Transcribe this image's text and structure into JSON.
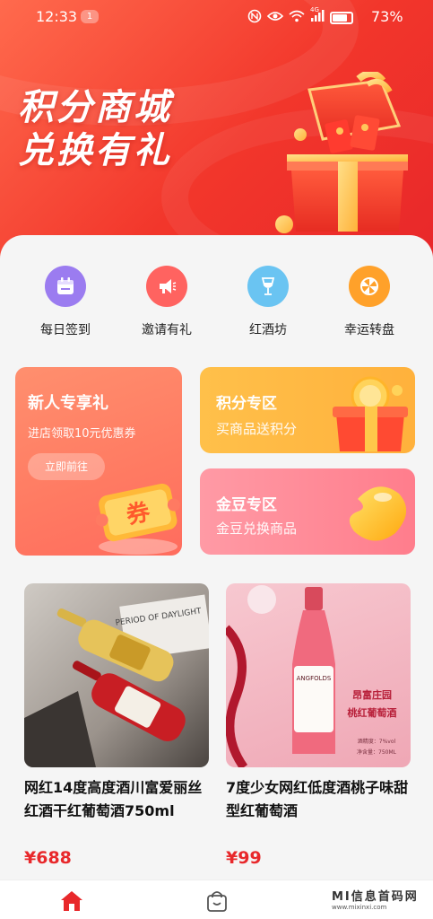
{
  "status_bar": {
    "time": "12:33",
    "notification_count": "1",
    "signal_label": "4G",
    "battery": "73%"
  },
  "hero": {
    "line1": "积分商城",
    "line2": "兑换有礼"
  },
  "quick_actions": [
    {
      "label": "每日签到",
      "icon": "calendar-icon",
      "color": "#9b7cf0"
    },
    {
      "label": "邀请有礼",
      "icon": "megaphone-icon",
      "color": "#ff6360"
    },
    {
      "label": "红酒坊",
      "icon": "wine-glass-icon",
      "color": "#6ac4f2"
    },
    {
      "label": "幸运转盘",
      "icon": "wheel-icon",
      "color": "#ffa12a"
    }
  ],
  "promos": {
    "new_user": {
      "title": "新人专享礼",
      "subtitle": "进店领取10元优惠券",
      "button": "立即前往",
      "badge": "券"
    },
    "points": {
      "title": "积分专区",
      "subtitle": "买商品送积分"
    },
    "bean": {
      "title": "金豆专区",
      "subtitle": "金豆兑换商品"
    }
  },
  "products": [
    {
      "name": "网红14度高度酒川富爱丽丝红酒干红葡萄酒750ml",
      "price": "¥688",
      "photo_text": "PERIOD OF DAYLIGHT"
    },
    {
      "name": "7度少女网红低度酒桃子味甜型红葡萄酒",
      "price": "¥99",
      "label_brand": "ANGFOLDS",
      "label_cn_1": "昂富庄园",
      "label_cn_2": "桃红葡萄酒",
      "spec_1": "酒精度：7%vol",
      "spec_2": "净含量：750ML"
    }
  ],
  "nav": {
    "items": [
      "home-icon",
      "shopping-bag-icon"
    ]
  },
  "watermark": {
    "text": "MI信息首码网",
    "url": "www.mixinxi.com"
  },
  "colors": {
    "accent": "#e8282b",
    "hero_start": "#ff6a4d",
    "hero_end": "#e8272a"
  }
}
